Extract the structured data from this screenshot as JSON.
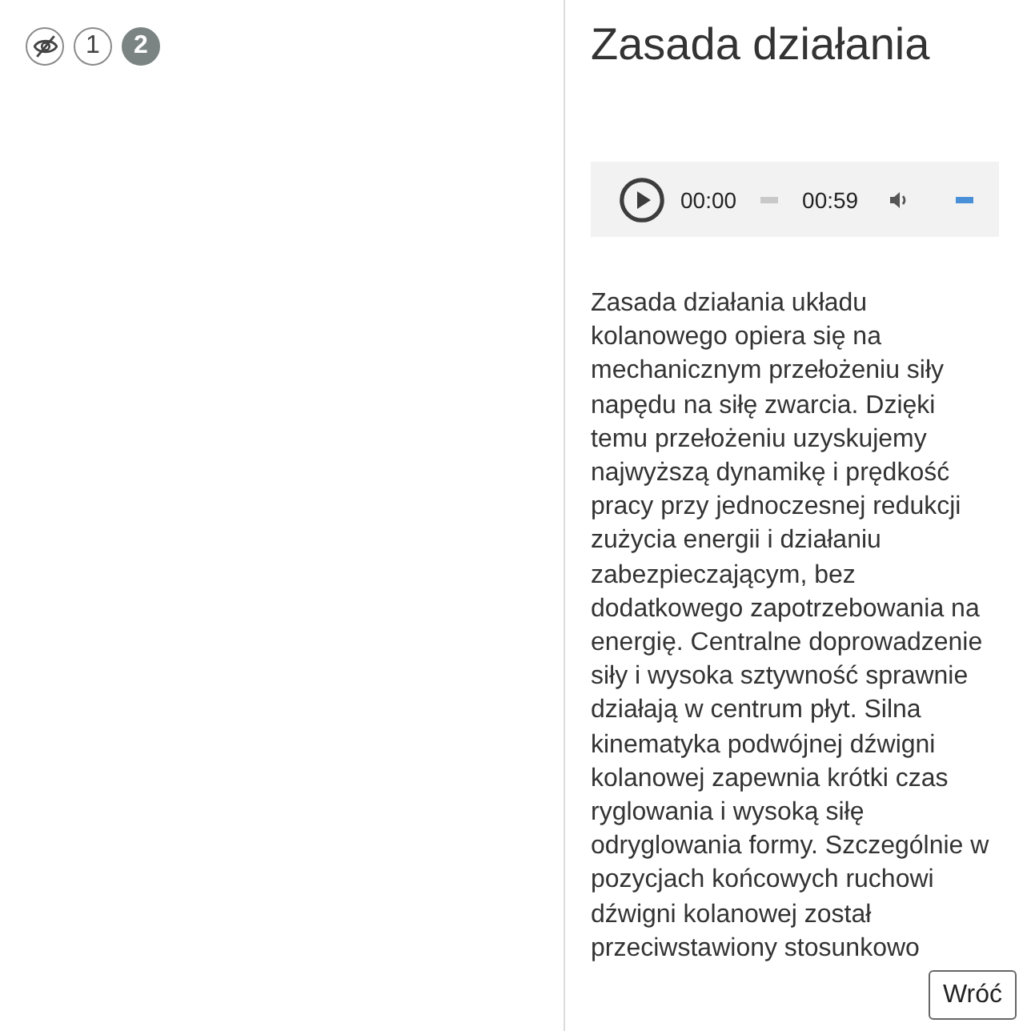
{
  "view_toggles": [
    {
      "kind": "hide",
      "selected": false
    },
    {
      "kind": "number",
      "label": "1",
      "selected": false
    },
    {
      "kind": "number",
      "label": "2",
      "selected": true
    }
  ],
  "panel": {
    "title": "Zasada działania",
    "audio_player": {
      "current_time": "00:00",
      "duration": "00:59",
      "progress": {
        "level": 0
      },
      "volume": {
        "level": 1
      }
    },
    "body": "Zasada działania układu kolanowego opiera się na mechanicznym przełożeniu siły napędu na siłę zwarcia. Dzięki temu przełożeniu uzyskujemy najwyższą dynamikę i prędkość pracy przy jednoczesnej redukcji zużycia energii i działaniu zabezpieczającym, bez dodatkowego zapotrzebowania na energię. Centralne doprowadzenie siły i wysoka sztywność sprawnie działają w centrum płyt. Silna kinematyka podwójnej dźwigni kolanowej zapewnia krótki czas ryglowania i wysoką siłę odryglowania formy. Szczególnie w pozycjach końcowych ruchowi dźwigni kolanowej został przeciwstawiony stosunkowo"
  },
  "back_button": "Wróć"
}
